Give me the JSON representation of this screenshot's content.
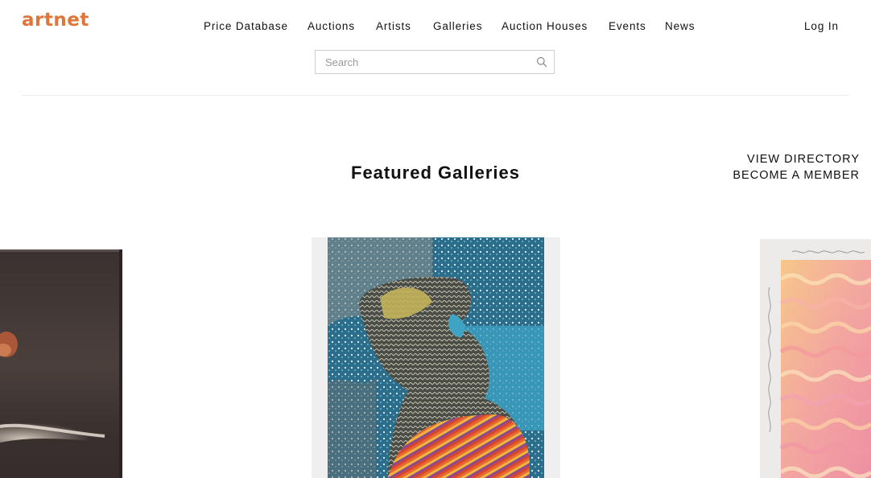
{
  "header": {
    "logo": "artnet",
    "nav": [
      {
        "label": "Price Database"
      },
      {
        "label": "Auctions"
      },
      {
        "label": "Artists"
      },
      {
        "label": "Galleries"
      },
      {
        "label": "Auction Houses"
      },
      {
        "label": "Events"
      },
      {
        "label": "News"
      }
    ],
    "login": "Log In",
    "search": {
      "placeholder": "Search",
      "value": ""
    }
  },
  "main": {
    "section_title": "Featured Galleries",
    "links": {
      "view_directory": "VIEW DIRECTORY",
      "become_member": "BECOME A MEMBER"
    },
    "featured_cards": [
      {
        "name": "dark-figure-painting"
      },
      {
        "name": "woven-figure-artwork"
      },
      {
        "name": "pink-wave-painting"
      }
    ]
  },
  "colors": {
    "brand": "#e0753a",
    "text": "#111111",
    "border": "#cfcfcf",
    "divider": "#ececec"
  },
  "icons": {
    "search": "search-icon"
  }
}
